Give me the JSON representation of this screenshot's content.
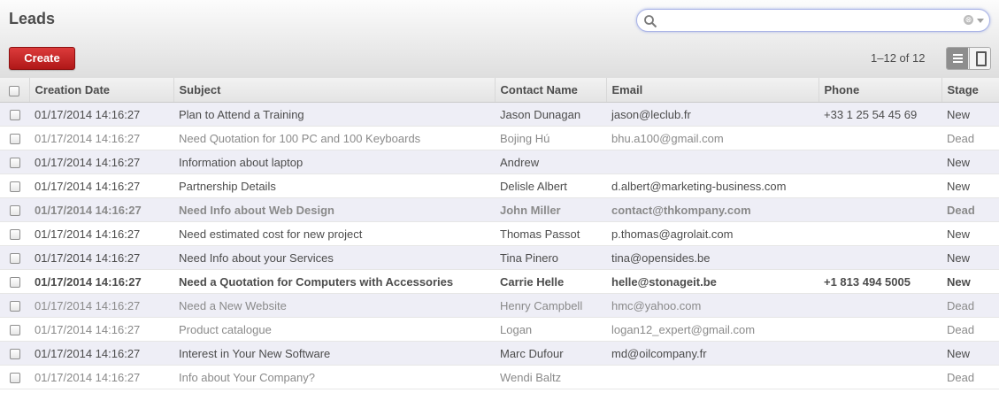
{
  "page": {
    "title": "Leads"
  },
  "search": {
    "placeholder": "",
    "value": "",
    "clear_glyph": "⊗"
  },
  "toolbar": {
    "create_label": "Create",
    "pager_text": "1–12 of 12"
  },
  "icons": [
    "search-icon",
    "clear-search-icon",
    "chevron-down-icon",
    "list-view-icon",
    "form-view-icon",
    "checkbox-icon"
  ],
  "colors": {
    "create_button": "#c62a2a",
    "odd_row": "#eeeef6",
    "search_border": "#aab4e6"
  },
  "table": {
    "columns": [
      "Creation Date",
      "Subject",
      "Contact Name",
      "Email",
      "Phone",
      "Stage"
    ],
    "rows": [
      {
        "date": "01/17/2014 14:16:27",
        "subject": "Plan to Attend a Training",
        "contact": "Jason Dunagan",
        "email": "jason@leclub.fr",
        "phone": "+33 1 25 54 45 69",
        "stage": "New"
      },
      {
        "date": "01/17/2014 14:16:27",
        "subject": "Need Quotation for 100 PC and 100 Keyboards",
        "contact": "Bojing Hú",
        "email": "bhu.a100@gmail.com",
        "phone": "",
        "stage": "Dead"
      },
      {
        "date": "01/17/2014 14:16:27",
        "subject": "Information about laptop",
        "contact": "Andrew",
        "email": "",
        "phone": "",
        "stage": "New"
      },
      {
        "date": "01/17/2014 14:16:27",
        "subject": "Partnership Details",
        "contact": "Delisle Albert",
        "email": "d.albert@marketing-business.com",
        "phone": "",
        "stage": "New"
      },
      {
        "date": "01/17/2014 14:16:27",
        "subject": "Need Info about Web Design",
        "contact": "John Miller",
        "email": "contact@thkompany.com",
        "phone": "",
        "stage": "Dead"
      },
      {
        "date": "01/17/2014 14:16:27",
        "subject": "Need estimated cost for new project",
        "contact": "Thomas Passot",
        "email": "p.thomas@agrolait.com",
        "phone": "",
        "stage": "New"
      },
      {
        "date": "01/17/2014 14:16:27",
        "subject": "Need Info about your Services",
        "contact": "Tina Pinero",
        "email": "tina@opensides.be",
        "phone": "",
        "stage": "New"
      },
      {
        "date": "01/17/2014 14:16:27",
        "subject": "Need a Quotation for Computers with Accessories",
        "contact": "Carrie Helle",
        "email": "helle@stonageit.be",
        "phone": "+1 813 494 5005",
        "stage": "New"
      },
      {
        "date": "01/17/2014 14:16:27",
        "subject": "Need a New Website",
        "contact": "Henry Campbell",
        "email": "hmc@yahoo.com",
        "phone": "",
        "stage": "Dead"
      },
      {
        "date": "01/17/2014 14:16:27",
        "subject": "Product catalogue",
        "contact": "Logan",
        "email": "logan12_expert@gmail.com",
        "phone": "",
        "stage": "Dead"
      },
      {
        "date": "01/17/2014 14:16:27",
        "subject": "Interest in Your New Software",
        "contact": "Marc Dufour",
        "email": "md@oilcompany.fr",
        "phone": "",
        "stage": "New"
      },
      {
        "date": "01/17/2014 14:16:27",
        "subject": "Info about Your Company?",
        "contact": "Wendi Baltz",
        "email": "",
        "phone": "",
        "stage": "Dead"
      }
    ]
  }
}
